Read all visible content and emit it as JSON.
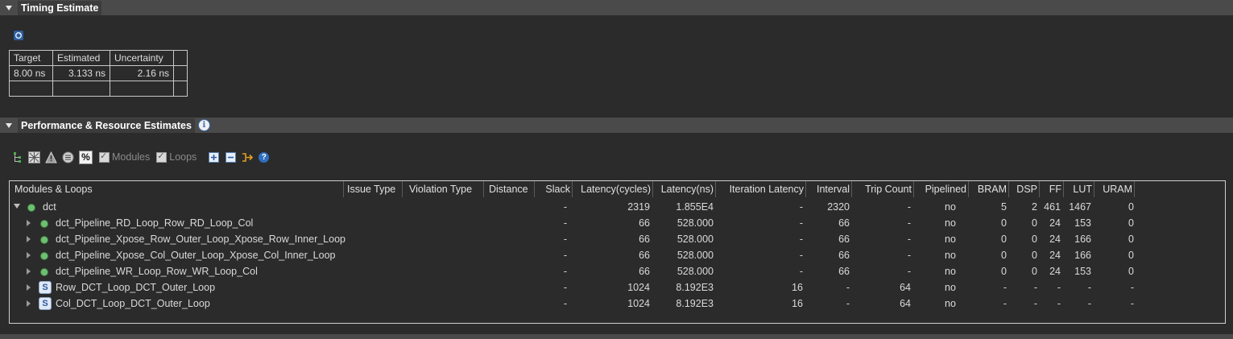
{
  "timing": {
    "title": "Timing Estimate",
    "columns": [
      "Target",
      "Estimated",
      "Uncertainty",
      ""
    ],
    "rows": [
      [
        "8.00 ns",
        "3.133 ns",
        "2.16 ns",
        ""
      ],
      [
        "",
        "",
        "",
        ""
      ]
    ]
  },
  "perf": {
    "title": "Performance & Resource Estimates",
    "toolbar": {
      "modules_label": "Modules",
      "loops_label": "Loops"
    },
    "columns": [
      "Modules & Loops",
      "Issue Type",
      "Violation Type",
      "Distance",
      "Slack",
      "Latency(cycles)",
      "Latency(ns)",
      "Iteration Latency",
      "Interval",
      "Trip Count",
      "Pipelined",
      "BRAM",
      "DSP",
      "FF",
      "LUT",
      "URAM"
    ],
    "rows": [
      {
        "name": "dct",
        "kind": "module",
        "level": 0,
        "expanded": true,
        "slack": "-",
        "lat_cycles": "2319",
        "lat_ns": "1.855E4",
        "iter_lat": "-",
        "interval": "2320",
        "trip": "-",
        "pipelined": "no",
        "bram": "5",
        "dsp": "2",
        "ff": "461",
        "lut": "1467",
        "uram": "0"
      },
      {
        "name": "dct_Pipeline_RD_Loop_Row_RD_Loop_Col",
        "kind": "module",
        "level": 1,
        "slack": "-",
        "lat_cycles": "66",
        "lat_ns": "528.000",
        "iter_lat": "-",
        "interval": "66",
        "trip": "-",
        "pipelined": "no",
        "bram": "0",
        "dsp": "0",
        "ff": "24",
        "lut": "153",
        "uram": "0"
      },
      {
        "name": "dct_Pipeline_Xpose_Row_Outer_Loop_Xpose_Row_Inner_Loop",
        "kind": "module",
        "level": 1,
        "slack": "-",
        "lat_cycles": "66",
        "lat_ns": "528.000",
        "iter_lat": "-",
        "interval": "66",
        "trip": "-",
        "pipelined": "no",
        "bram": "0",
        "dsp": "0",
        "ff": "24",
        "lut": "166",
        "uram": "0"
      },
      {
        "name": "dct_Pipeline_Xpose_Col_Outer_Loop_Xpose_Col_Inner_Loop",
        "kind": "module",
        "level": 1,
        "slack": "-",
        "lat_cycles": "66",
        "lat_ns": "528.000",
        "iter_lat": "-",
        "interval": "66",
        "trip": "-",
        "pipelined": "no",
        "bram": "0",
        "dsp": "0",
        "ff": "24",
        "lut": "166",
        "uram": "0"
      },
      {
        "name": "dct_Pipeline_WR_Loop_Row_WR_Loop_Col",
        "kind": "module",
        "level": 1,
        "slack": "-",
        "lat_cycles": "66",
        "lat_ns": "528.000",
        "iter_lat": "-",
        "interval": "66",
        "trip": "-",
        "pipelined": "no",
        "bram": "0",
        "dsp": "0",
        "ff": "24",
        "lut": "153",
        "uram": "0"
      },
      {
        "name": "Row_DCT_Loop_DCT_Outer_Loop",
        "kind": "loop",
        "level": 1,
        "slack": "-",
        "lat_cycles": "1024",
        "lat_ns": "8.192E3",
        "iter_lat": "16",
        "interval": "-",
        "trip": "64",
        "pipelined": "no",
        "bram": "-",
        "dsp": "-",
        "ff": "-",
        "lut": "-",
        "uram": "-"
      },
      {
        "name": "Col_DCT_Loop_DCT_Outer_Loop",
        "kind": "loop",
        "level": 1,
        "slack": "-",
        "lat_cycles": "1024",
        "lat_ns": "8.192E3",
        "iter_lat": "16",
        "interval": "-",
        "trip": "64",
        "pipelined": "no",
        "bram": "-",
        "dsp": "-",
        "ff": "-",
        "lut": "-",
        "uram": "-"
      }
    ]
  },
  "icons": {
    "loop_glyph": "S",
    "info_glyph": "i",
    "percent_glyph": "%",
    "help_glyph": "?"
  }
}
